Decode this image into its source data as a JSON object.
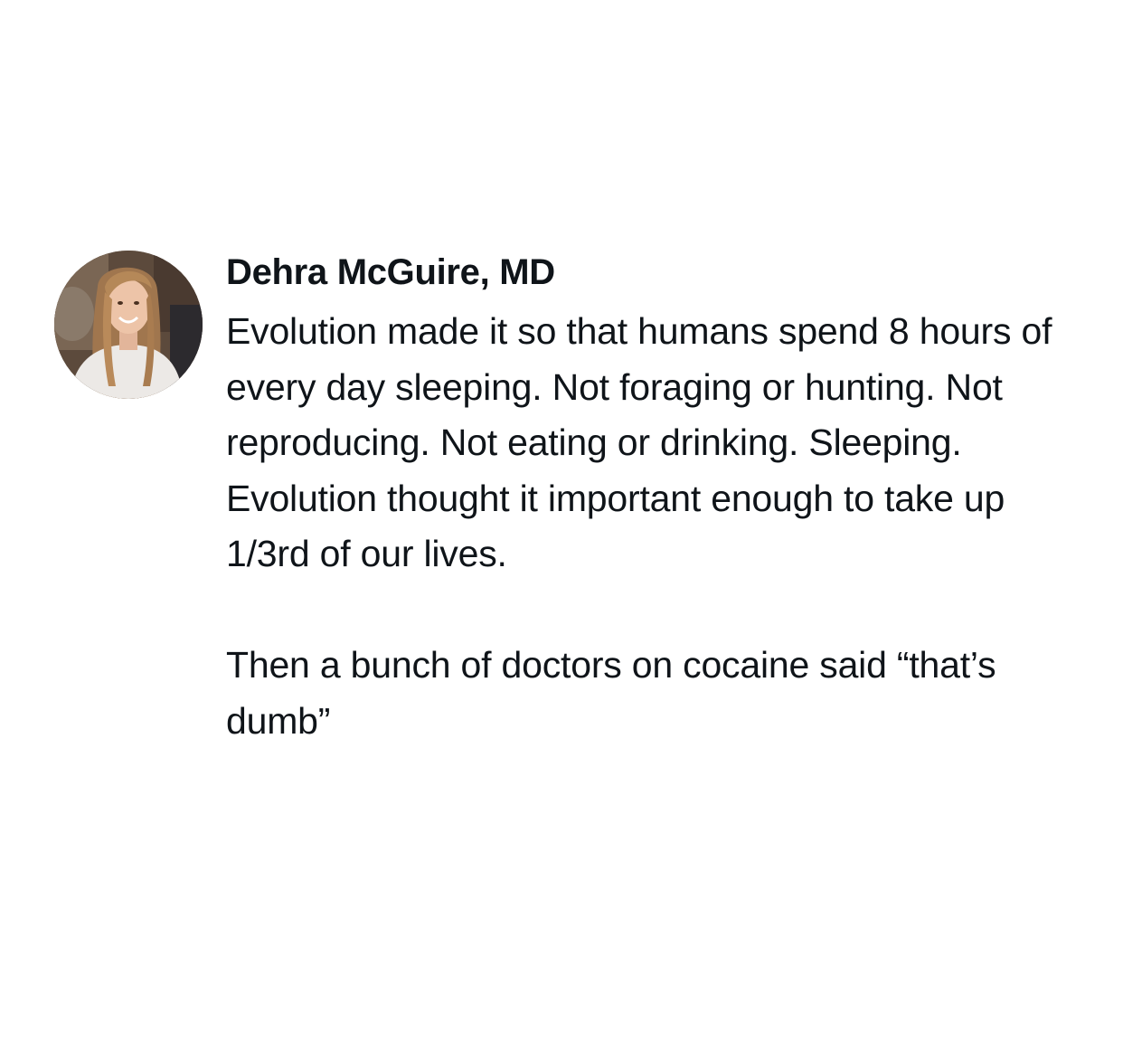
{
  "tweet": {
    "author_name": "Dehra McGuire, MD",
    "avatar_icon": "profile-photo",
    "paragraphs": [
      "Evolution made it so that humans spend 8 hours of every day sleeping. Not foraging or hunting. Not reproducing. Not eating or drinking. Sleeping. Evolution thought it important enough to take up 1/3rd of our lives.",
      "Then a bunch of doctors on cocaine said “that’s dumb”"
    ]
  }
}
